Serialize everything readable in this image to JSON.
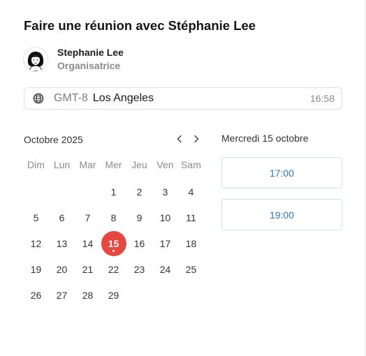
{
  "title": "Faire une réunion avec Stéphanie Lee",
  "organizer": {
    "name": "Stephanie Lee",
    "role": "Organisatrice",
    "avatar_icon": "avatar-illustration"
  },
  "timezone": {
    "offset": "GMT-8",
    "city": "Los Angeles",
    "current_time": "16:58",
    "icon": "globe-icon"
  },
  "calendar": {
    "month_label": "Octobre 2025",
    "prev_icon": "chevron-left-icon",
    "next_icon": "chevron-right-icon",
    "weekdays": [
      "Dim",
      "Lun",
      "Mar",
      "Mer",
      "Jeu",
      "Ven",
      "Sam"
    ],
    "leading_blanks": 3,
    "days_in_month": 29,
    "selected_day": 15,
    "selected_color": "#e8473f"
  },
  "slots": {
    "date_label": "Mercredi 15 octobre",
    "times": [
      "17:00",
      "19:00"
    ],
    "accent": "#2a78c9"
  }
}
